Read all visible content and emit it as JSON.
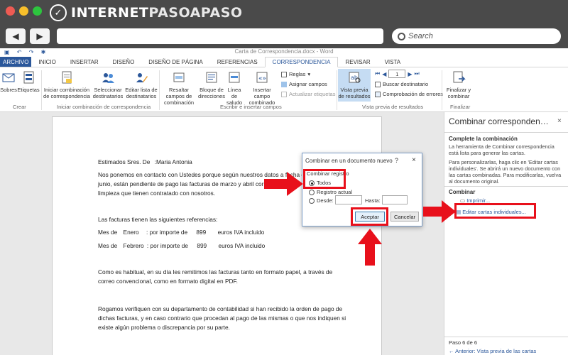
{
  "browser": {
    "logo_main": "INTERNET",
    "logo_accent": "PASOAPASO",
    "search_placeholder": "Search",
    "colors": {
      "traffic_red": "#ee5b53",
      "traffic_yellow": "#f7bf2b",
      "traffic_green": "#2dc53e",
      "chrome": "#4a4a4a"
    }
  },
  "word": {
    "window_title": "Carta de Correspondencia.docx - Word",
    "tabs": [
      "ARCHIVO",
      "INICIO",
      "INSERTAR",
      "DISEÑO",
      "DISEÑO DE PÁGINA",
      "REFERENCIAS",
      "CORRESPONDENCIA",
      "REVISAR",
      "VISTA"
    ],
    "active_tab": "CORRESPONDENCIA",
    "accent_color": "#2b579a",
    "ribbon": {
      "sobres": "Sobres",
      "etiquetas": "Etiquetas",
      "crear_group": "Crear",
      "iniciar_combinacion": "Iniciar combinación de correspondencia",
      "seleccionar_destinatarios": "Seleccionar destinatarios",
      "editar_lista": "Editar lista de destinatarios",
      "iniciar_group": "Iniciar combinación de correspondencia",
      "resaltar_campos": "Resaltar campos de combinación",
      "bloque_direcciones": "Bloque de direcciones",
      "linea_saludo": "Línea de saludo",
      "insertar_campo": "Insertar campo combinado",
      "reglas": "Reglas",
      "asignar_campos": "Asignar campos",
      "actualizar_etiquetas": "Actualizar etiquetas",
      "escribir_group": "Escribir e insertar campos",
      "vista_previa": "Vista previa de resultados",
      "record_number": "1",
      "buscar_destinatario": "Buscar destinatario",
      "comprobacion_errores": "Comprobación de errores",
      "vista_group": "Vista previa de resultados",
      "finalizar_combinar": "Finalizar y combinar",
      "finalizar_group": "Finalizar"
    },
    "letter": {
      "greeting": "Estimados Sres. De",
      "name": ":Maria Antonia",
      "p1_l1": "Nos ponemos en contacto con Ustedes porque según nuestros datos a fecha de",
      "p1_l2": "junio, están pendiente de pago las facturas de marzo y abril correspondientes",
      "p1_l3": "limpieza que tienen contratado con nosotros.",
      "p2": "Las facturas tienen las siguientes referencias:",
      "mes_label": "Mes de",
      "row1_month": "Enero",
      "row2_month": "Febrero",
      "por_importe": ": por importe de",
      "amount": "899",
      "euros_iva": "euros IVA incluido",
      "p3_l1": "Como es habitual, en su día les remitimos las facturas tanto en formato papel, a través de",
      "p3_l2": "correo convencional, como en formato digital en PDF.",
      "p4_l1": "Rogamos verifiquen con su departamento de contabilidad si han recibido la orden de pago de",
      "p4_l2": "dichas facturas, y en caso contrario que procedan al pago de las mismas o que nos indiquen si",
      "p4_l3": "existe algún problema o discrepancia por su parte."
    },
    "pane": {
      "title": "Combinar corresponden…",
      "close": "×",
      "complete_heading": "Complete la combinación",
      "complete_text": "La herramienta de Combinar correspondencia está lista para generar las cartas.",
      "personalize_text": "Para personalizarlas, haga clic en 'Editar cartas individuales'. Se abrirá un nuevo documento con las cartas combinadas. Para modificarlas, vuelva al documento original.",
      "combinar_heading": "Combinar",
      "imprimir": "Imprimir...",
      "editar_cartas": "Editar cartas individuales...",
      "step": "Paso 6 de 6",
      "previous": "Anterior: Vista previa de las cartas"
    },
    "dialog": {
      "title": "Combinar en un documento nuevo",
      "help": "?",
      "close": "×",
      "group_label": "Combinar registro",
      "todos": "Todos",
      "registro_actual": "Registro actual",
      "desde": "Desde:",
      "hasta": "Hasta:",
      "selected": "todos",
      "aceptar": "Aceptar",
      "cancelar": "Cancelar"
    },
    "highlight_color": "#e8101b"
  }
}
